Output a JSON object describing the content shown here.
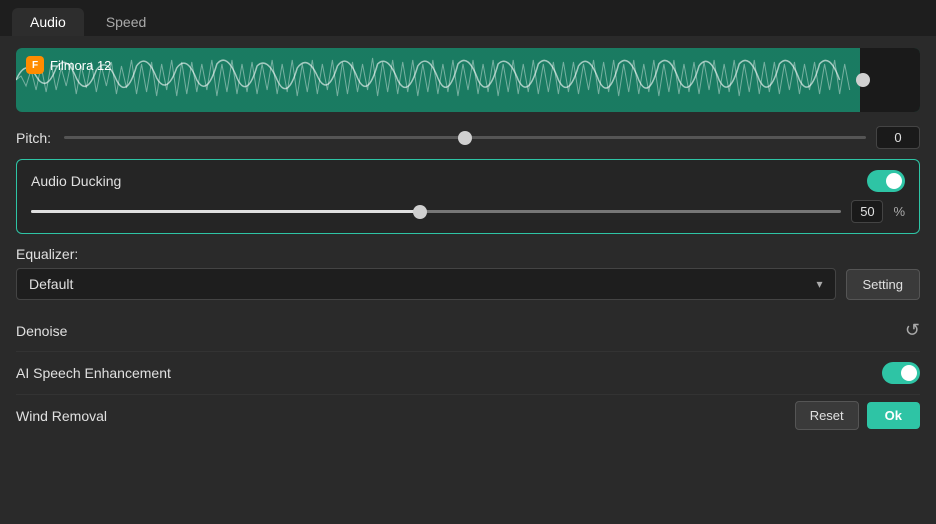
{
  "tabs": [
    {
      "id": "audio",
      "label": "Audio",
      "active": true
    },
    {
      "id": "speed",
      "label": "Speed",
      "active": false
    }
  ],
  "waveform": {
    "title": "Filmora 12"
  },
  "pitch": {
    "label": "Pitch:",
    "value": "0",
    "thumb_position_pct": 50
  },
  "audio_ducking": {
    "label": "Audio Ducking",
    "enabled": true,
    "value": "50",
    "percent": "%"
  },
  "equalizer": {
    "label": "Equalizer:",
    "selected": "Default",
    "setting_btn": "Setting"
  },
  "denoise": {
    "label": "Denoise"
  },
  "ai_speech_enhancement": {
    "label": "AI Speech Enhancement",
    "enabled": true
  },
  "wind_removal": {
    "label": "Wind Removal",
    "enabled": true
  },
  "bottom": {
    "reset_label": "Reset",
    "ok_label": "Ok"
  }
}
